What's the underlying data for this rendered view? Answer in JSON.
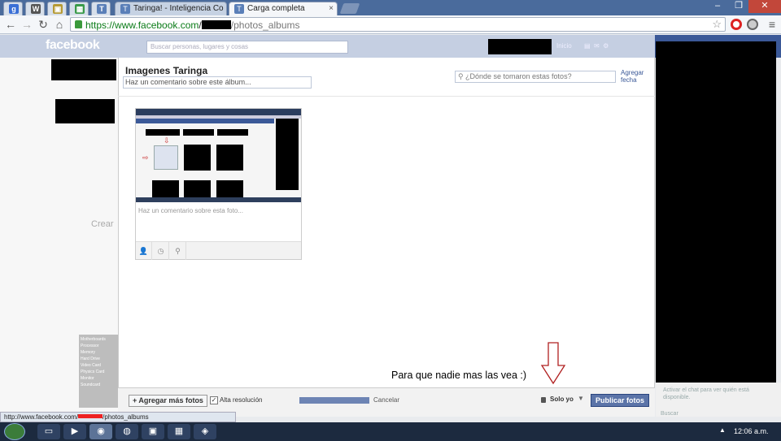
{
  "browser": {
    "tabs": [
      {
        "label": "Taringa! - Inteligencia Co",
        "icon": "taringa-icon"
      },
      {
        "label": "Carga completa",
        "icon": "taringa-icon",
        "active": true
      }
    ],
    "pinned_tabs": [
      "google-icon",
      "wordpress-icon",
      "extension-icon",
      "grid-icon",
      "taringa-icon"
    ],
    "url": {
      "prefix": "https://",
      "host": "www.facebook.com",
      "slash": "/",
      "path": "/photos_albums"
    },
    "status_url": "http://www.facebook.com/",
    "status_url_tail": "/photos_albums"
  },
  "facebook": {
    "logo": "facebook",
    "search_placeholder": "Buscar personas, lugares y cosas",
    "nav_home": "Inicio"
  },
  "dialog": {
    "album_title": "Imagenes Taringa",
    "album_comment_placeholder": "Haz un comentario sobre este álbum...",
    "location_placeholder": "¿Dónde se tomaron estas fotos?",
    "add_date_line1": "Agregar",
    "add_date_line2": "fecha",
    "photo_comment_placeholder": "Haz un comentario sobre esta foto...",
    "footer": {
      "add_more": "+ Agregar más fotos",
      "hires_label": "Alta resolución",
      "hires_checked": true,
      "progress": 1.0,
      "cancel": "Cancelar",
      "privacy": "Solo yo",
      "publish": "Publicar fotos"
    }
  },
  "annotation": {
    "text": "Para que nadie mas las vea :)",
    "color": "#b02020"
  },
  "background": {
    "create_text": "Crear",
    "chat_notice": "Activar el chat para ver quién está disponible.",
    "chat_search": "Buscar",
    "sidebar_list": [
      "Motherboards",
      "Processor",
      "Memory",
      "Hard Drive",
      "Video Card",
      "Physics Card",
      "Monitor",
      "Soundcard"
    ]
  },
  "taskbar": {
    "clock": "12:06 a.m."
  }
}
